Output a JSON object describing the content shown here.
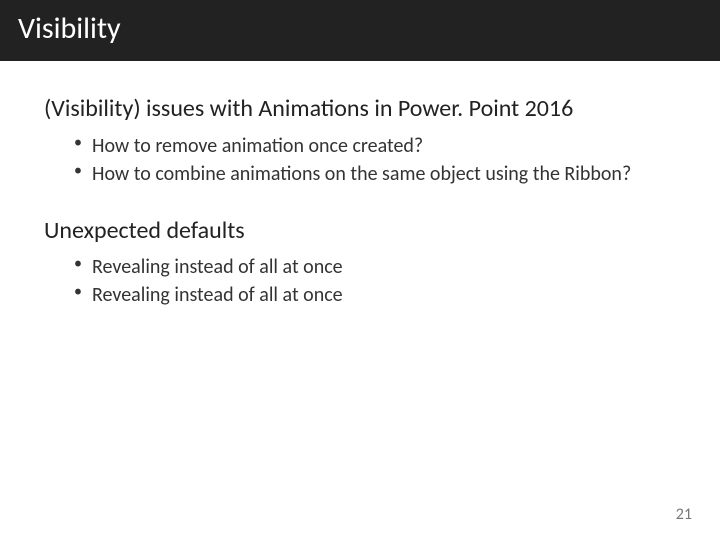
{
  "title": "Visibility",
  "sections": [
    {
      "heading": "(Visibility) issues with Animations in Power. Point 2016",
      "bullets": [
        "How to remove animation once created?",
        "How to combine animations on the same object using the Ribbon?"
      ]
    },
    {
      "heading": "Unexpected defaults",
      "bullets": [
        "Revealing instead of all at once",
        "Revealing instead of all at once"
      ]
    }
  ],
  "page_number": "21"
}
